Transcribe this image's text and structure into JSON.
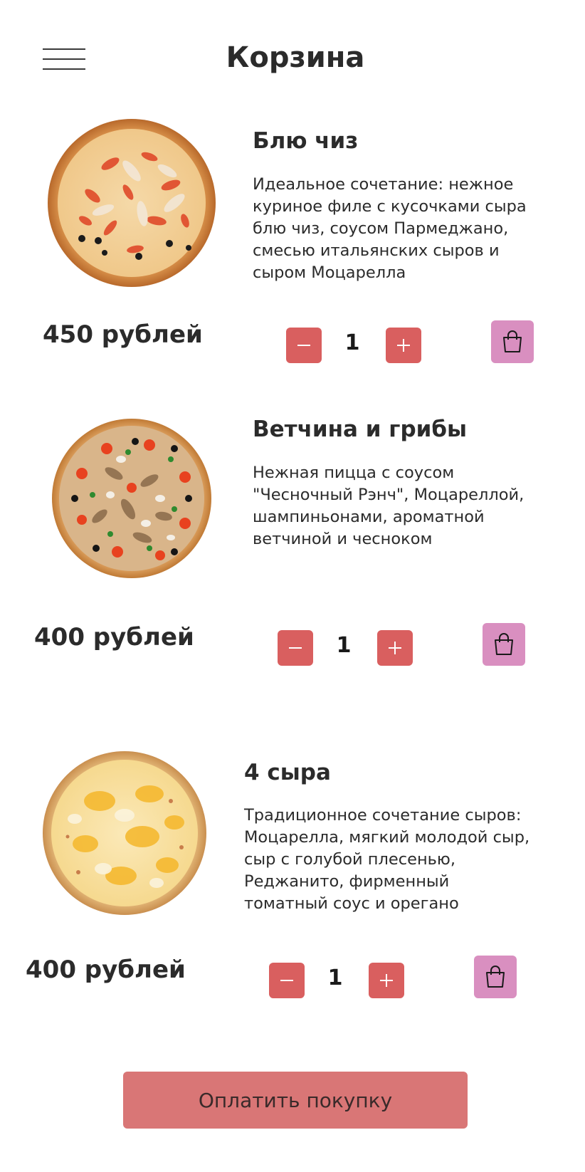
{
  "header": {
    "title": "Корзина",
    "menu_icon": "hamburger-menu-icon"
  },
  "items": [
    {
      "title": "Блю чиз",
      "description": "Идеальное сочетание: нежное\nкуриное филе с кусочками сыра\nблю чиз, соусом Пармеджано,\nсмесью итальянских сыров и\nсыром Моцарелла",
      "price": "450 рублей",
      "quantity": "1",
      "image": "pizza-blue-cheese"
    },
    {
      "title": "Ветчина и грибы",
      "description": "Нежная пицца с соусом\n\"Чесночный Рэнч\", Моцареллой,\nшампиньонами, ароматной\nветчиной и чесноком",
      "price": "400 рублей",
      "quantity": "1",
      "image": "pizza-ham-mushrooms"
    },
    {
      "title": "4 сыра",
      "description": "Традиционное сочетание сыров:\nМоцарелла, мягкий молодой сыр,\nсыр с голубой плесенью,\nРеджанито, фирменный\nтоматный соус и орегано",
      "price": "400 рублей",
      "quantity": "1",
      "image": "pizza-four-cheese"
    }
  ],
  "pay_button": {
    "label": "Оплатить покупку"
  },
  "colors": {
    "qty_button": "#d95f5f",
    "bag_button": "#d98fc0",
    "pay_button": "#d97676",
    "text": "#2b2b2b"
  }
}
